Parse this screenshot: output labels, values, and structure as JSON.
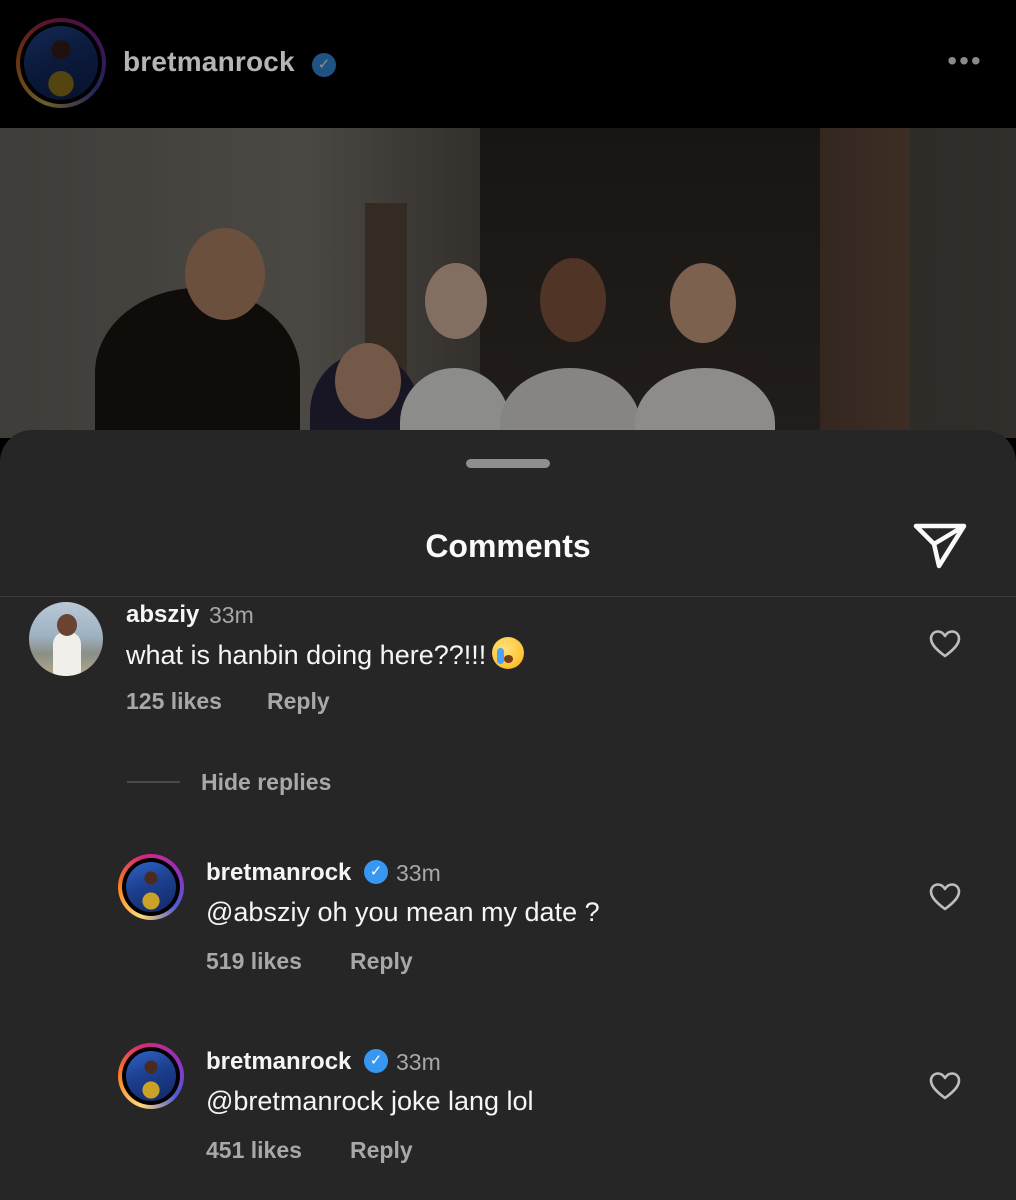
{
  "post": {
    "username": "bretmanrock",
    "more_icon": "more-horizontal-icon"
  },
  "sheet": {
    "title": "Comments",
    "share_icon": "send-icon"
  },
  "comments": [
    {
      "username": "absziy",
      "time": "33m",
      "text": "what is hanbin doing here??!!!",
      "emoji": "loudly-crying-face-emoji",
      "likes": "125 likes",
      "reply": "Reply",
      "verified": false
    }
  ],
  "hide_replies": "Hide replies",
  "replies": [
    {
      "username": "bretmanrock",
      "time": "33m",
      "text": "@absziy oh you mean my date ?",
      "likes": "519 likes",
      "reply": "Reply",
      "verified": true
    },
    {
      "username": "bretmanrock",
      "time": "33m",
      "text": "@bretmanrock joke lang lol",
      "likes": "451 likes",
      "reply": "Reply",
      "verified": true
    }
  ],
  "colors": {
    "background": "#000000",
    "sheet": "#262626",
    "verified": "#3897f0",
    "secondary_text": "#a8a8a8"
  }
}
